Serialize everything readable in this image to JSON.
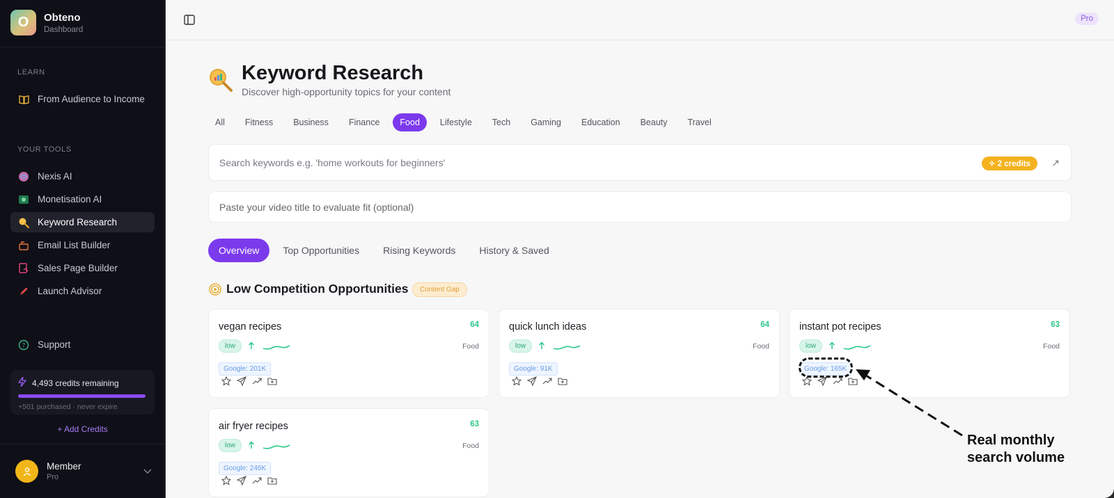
{
  "brand": {
    "name": "Obteno",
    "sub": "Dashboard",
    "logo_letter": "O"
  },
  "sidebar": {
    "learn_label": "LEARN",
    "learn_items": [
      {
        "label": "From Audience to Income",
        "icon": "book-icon"
      }
    ],
    "tools_label": "YOUR TOOLS",
    "tools": [
      {
        "label": "Nexis AI",
        "icon": "brain-icon"
      },
      {
        "label": "Monetisation AI",
        "icon": "money-icon"
      },
      {
        "label": "Keyword Research",
        "icon": "magnifier-icon",
        "active": true
      },
      {
        "label": "Email List Builder",
        "icon": "mailbox-icon"
      },
      {
        "label": "Sales Page Builder",
        "icon": "page-chart-icon"
      },
      {
        "label": "Launch Advisor",
        "icon": "rocket-icon"
      }
    ],
    "support_label": "Support",
    "credits": {
      "text": "4,493 credits remaining",
      "note": "+501 purchased · never expire",
      "fill": 1.0
    },
    "add_credits": "+ Add Credits",
    "member": {
      "name": "Member",
      "role": "Pro"
    }
  },
  "topbar": {
    "badge": "Pro"
  },
  "page": {
    "title": "Keyword Research",
    "subtitle": "Discover high-opportunity topics for your content",
    "categories": [
      "All",
      "Fitness",
      "Business",
      "Finance",
      "Food",
      "Lifestyle",
      "Tech",
      "Gaming",
      "Education",
      "Beauty",
      "Travel"
    ],
    "active_category": "Food",
    "search_placeholder": "Search keywords e.g. 'home workouts for beginners'",
    "search_credits": "2 credits",
    "title_placeholder": "Paste your video title to evaluate fit (optional)",
    "tabs": [
      "Overview",
      "Top Opportunities",
      "Rising Keywords",
      "History & Saved"
    ],
    "active_tab": "Overview",
    "section_title": "Low Competition Opportunities",
    "section_badge": "Content Gap"
  },
  "cards": [
    {
      "keyword": "vegan recipes",
      "score": "64",
      "competition": "low",
      "category": "Food",
      "google": "Google: 201K"
    },
    {
      "keyword": "quick lunch ideas",
      "score": "64",
      "competition": "low",
      "category": "Food",
      "google": "Google: 91K"
    },
    {
      "keyword": "instant pot recipes",
      "score": "63",
      "competition": "low",
      "category": "Food",
      "google": "Google: 165K"
    },
    {
      "keyword": "air fryer recipes",
      "score": "63",
      "competition": "low",
      "category": "Food",
      "google": "Google: 246K"
    }
  ],
  "annotation": {
    "line1": "Real monthly",
    "line2": "search volume"
  },
  "colors": {
    "accent": "#7c3aed",
    "score": "#2ec98a",
    "credits": "#f4b21f",
    "sidebar_bg": "#0f0f17"
  }
}
